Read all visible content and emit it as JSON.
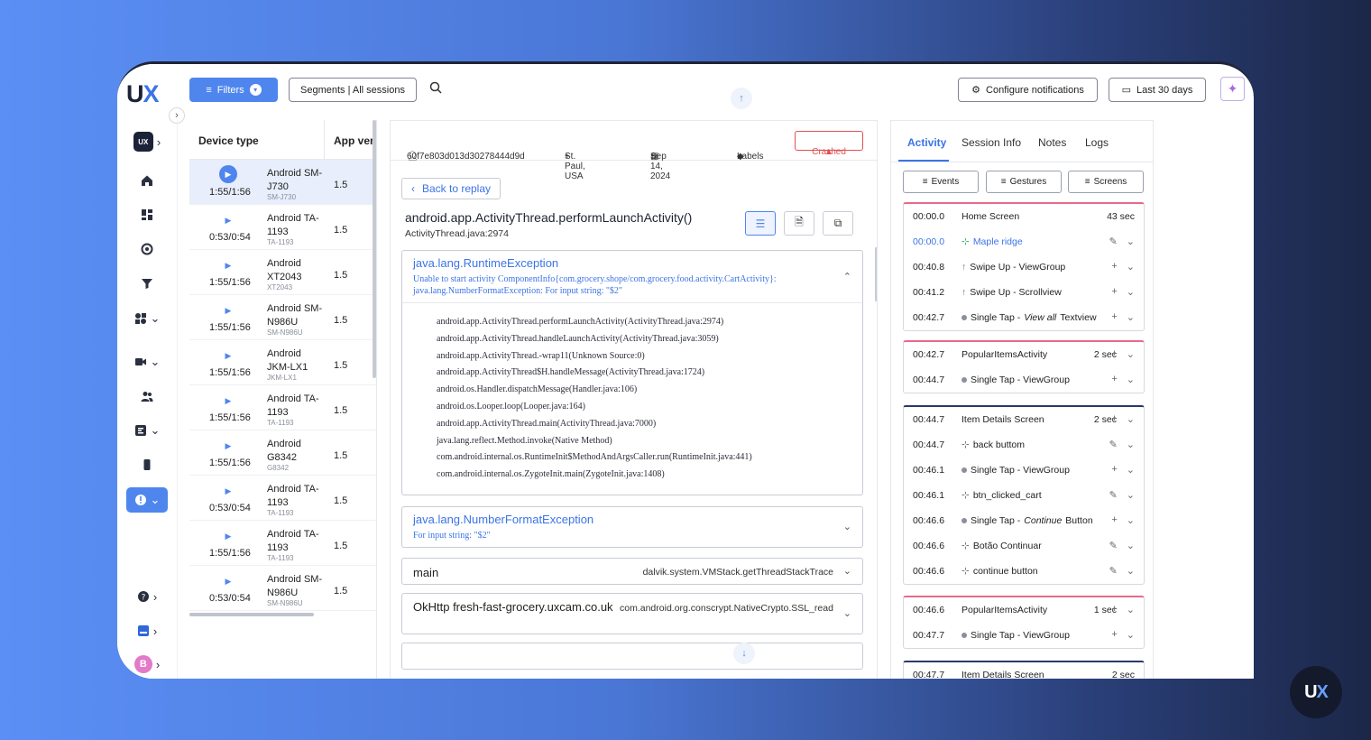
{
  "brand": {
    "logo_u": "U",
    "logo_x": "X",
    "chip": "UX",
    "avatar_letter": "B"
  },
  "topbar": {
    "filters_label": "Filters",
    "segments_label": "Segments | All sessions",
    "configure_label": "Configure notifications",
    "date_range_label": "Last 30 days"
  },
  "device_list": {
    "header_device": "Device type",
    "header_version": "App version",
    "rows": [
      {
        "duration": "1:55/1:56",
        "name": "Android SM-J730",
        "model": "SM-J730",
        "version": "1.5",
        "selected": true
      },
      {
        "duration": "0:53/0:54",
        "name": "Android TA-1193",
        "model": "TA-1193",
        "version": "1.5"
      },
      {
        "duration": "1:55/1:56",
        "name": "Android XT2043",
        "model": "XT2043",
        "version": "1.5"
      },
      {
        "duration": "1:55/1:56",
        "name": "Android SM-N986U",
        "model": "SM-N986U",
        "version": "1.5"
      },
      {
        "duration": "1:55/1:56",
        "name": "Android JKM-LX1",
        "model": "JKM-LX1",
        "version": "1.5"
      },
      {
        "duration": "1:55/1:56",
        "name": "Android TA-1193",
        "model": "TA-1193",
        "version": "1.5"
      },
      {
        "duration": "1:55/1:56",
        "name": "Android G8342",
        "model": "G8342",
        "version": "1.5"
      },
      {
        "duration": "0:53/0:54",
        "name": "Android TA-1193",
        "model": "TA-1193",
        "version": "1.5"
      },
      {
        "duration": "1:55/1:56",
        "name": "Android TA-1193",
        "model": "TA-1193",
        "version": "1.5"
      },
      {
        "duration": "0:53/0:54",
        "name": "Android SM-N986U",
        "model": "SM-N986U",
        "version": "1.5"
      }
    ]
  },
  "session": {
    "user_id": "60f7e803d013d30278444d9d",
    "location": "St. Paul, USA",
    "date": "Sep 14, 2024",
    "labels": "Labels",
    "status": "Crashed"
  },
  "crash": {
    "back_label": "Back to replay",
    "function": "android.app.ActivityThread.performLaunchActivity()",
    "location": "ActivityThread.java:2974",
    "exception1": {
      "title": "java.lang.RuntimeException",
      "message": "Unable to start activity ComponentInfo{com.grocery.shope/com.grocery.food.activity.CartActivity}: java.lang.NumberFormatException: For input string: \"$2\"",
      "stack": [
        "android.app.ActivityThread.performLaunchActivity(ActivityThread.java:2974)",
        "android.app.ActivityThread.handleLaunchActivity(ActivityThread.java:3059)",
        "android.app.ActivityThread.-wrap11(Unknown Source:0)",
        "android.app.ActivityThread$H.handleMessage(ActivityThread.java:1724)",
        "android.os.Handler.dispatchMessage(Handler.java:106)",
        "android.os.Looper.loop(Looper.java:164)",
        "android.app.ActivityThread.main(ActivityThread.java:7000)",
        "java.lang.reflect.Method.invoke(Native Method)",
        "com.android.internal.os.RuntimeInit$MethodAndArgsCaller.run(RuntimeInit.java:441)",
        "com.android.internal.os.ZygoteInit.main(ZygoteInit.java:1408)"
      ]
    },
    "exception2": {
      "title": "java.lang.NumberFormatException",
      "message": "For input string: \"$2\""
    },
    "thread_main": {
      "name": "main",
      "value": "dalvik.system.VMStack.getThreadStackTrace"
    },
    "thread_okhttp": {
      "name": "OkHttp fresh-fast-grocery.uxcam.co.uk",
      "value": "com.android.org.conscrypt.NativeCrypto.SSL_read"
    }
  },
  "activity": {
    "tabs": [
      "Activity",
      "Session Info",
      "Notes",
      "Logs"
    ],
    "filters": [
      "Events",
      "Gestures",
      "Screens"
    ],
    "cards": [
      {
        "color": "pink",
        "screen": "Home Screen",
        "time": "00:00.0",
        "duration": "43 sec",
        "rows": [
          {
            "time": "00:00.0",
            "kind": "tap-icon",
            "label": "Maple ridge",
            "blue": true,
            "act": "edit"
          },
          {
            "time": "00:40.8",
            "kind": "swipe",
            "label": "Swipe Up - ViewGroup",
            "act": "add"
          },
          {
            "time": "00:41.2",
            "kind": "swipe",
            "label": "Swipe Up - Scrollview",
            "act": "add"
          },
          {
            "time": "00:42.7",
            "kind": "dot",
            "label": "Single Tap - ",
            "label_em": "View all",
            "label_tail": " Textview",
            "act": "add"
          }
        ]
      },
      {
        "color": "pink",
        "screen": "PopularItemsActivity",
        "time": "00:42.7",
        "duration": "2 sec",
        "rows": [
          {
            "time": "00:44.7",
            "kind": "dot",
            "label": "Single Tap - ViewGroup",
            "act": "add"
          }
        ]
      },
      {
        "color": "navy",
        "screen": "Item Details Screen",
        "time": "00:44.7",
        "duration": "2 sec",
        "rows": [
          {
            "time": "00:44.7",
            "kind": "tap-icon",
            "label": "back buttom",
            "act": "edit"
          },
          {
            "time": "00:46.1",
            "kind": "dot",
            "label": "Single Tap - ViewGroup",
            "act": "add"
          },
          {
            "time": "00:46.1",
            "kind": "tap-icon",
            "label": "btn_clicked_cart",
            "act": "edit"
          },
          {
            "time": "00:46.6",
            "kind": "dot",
            "label": "Single Tap - ",
            "label_em": "Continue",
            "label_tail": " Button",
            "act": "add"
          },
          {
            "time": "00:46.6",
            "kind": "tap-icon",
            "label": "Botão Continuar",
            "act": "edit"
          },
          {
            "time": "00:46.6",
            "kind": "tap-icon",
            "label": "continue button",
            "act": "edit"
          }
        ]
      },
      {
        "color": "pink",
        "screen": "PopularItemsActivity",
        "time": "00:46.6",
        "duration": "1 sec",
        "rows": [
          {
            "time": "00:47.7",
            "kind": "dot",
            "label": "Single Tap - ViewGroup",
            "act": "add"
          }
        ]
      },
      {
        "color": "navy",
        "screen": "Item Details Screen",
        "time": "00:47.7",
        "duration": "2 sec",
        "rows": []
      }
    ]
  }
}
